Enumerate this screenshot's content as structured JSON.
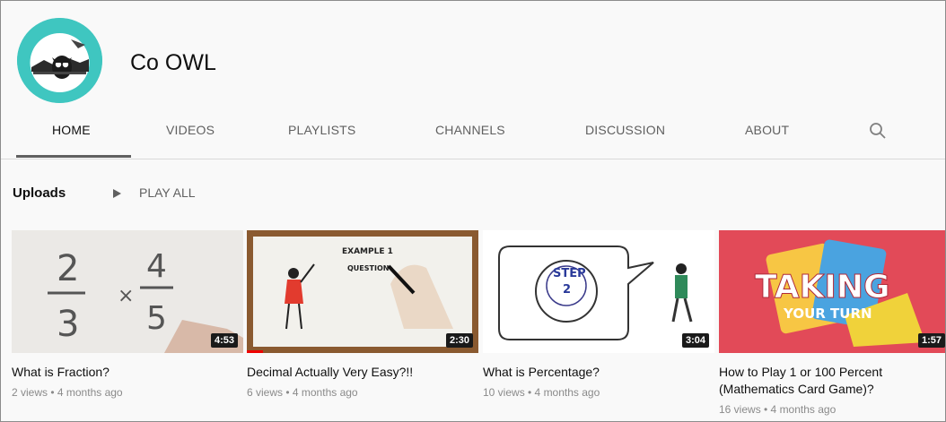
{
  "channel": {
    "name": "Co OWL"
  },
  "tabs": [
    {
      "label": "HOME"
    },
    {
      "label": "VIDEOS"
    },
    {
      "label": "PLAYLISTS"
    },
    {
      "label": "CHANNELS"
    },
    {
      "label": "DISCUSSION"
    },
    {
      "label": "ABOUT"
    }
  ],
  "active_tab": "HOME",
  "section": {
    "title": "Uploads",
    "play_all": "PLAY ALL"
  },
  "videos": [
    {
      "title": "What is Fraction?",
      "meta": "2 views • 4 months ago",
      "duration": "4:53",
      "thumb": {
        "n1": "2",
        "d1": "3",
        "op": "×",
        "n2": "4",
        "d2": "5"
      }
    },
    {
      "title": "Decimal Actually Very Easy?!!",
      "meta": "6 views • 4 months ago",
      "duration": "2:30",
      "thumb": {
        "line1": "EXAMPLE 1",
        "line2": "QUESTION"
      }
    },
    {
      "title": "What is Percentage?",
      "meta": "10 views • 4 months ago",
      "duration": "3:04",
      "thumb": {
        "line1": "STEP",
        "line2": "2"
      }
    },
    {
      "title": "How to Play 1 or 100 Percent (Mathematics Card Game)?",
      "meta": "16 views • 4 months ago",
      "duration": "1:57",
      "thumb": {
        "line1": "TAKING",
        "line2": "YOUR TURN"
      }
    }
  ],
  "colors": {
    "avatar_bg": "#3fc6c0",
    "card4_bg": "#e04a57",
    "progress": "#ee0000"
  }
}
